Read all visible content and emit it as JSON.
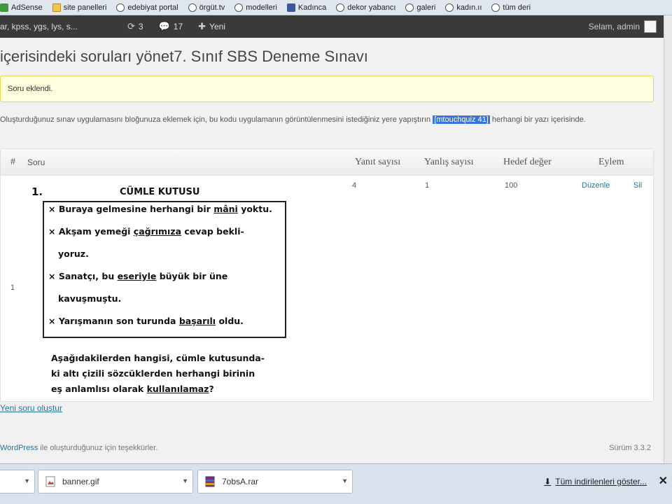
{
  "bookmarks": [
    {
      "label": "AdSense",
      "icon": "green-square-icon"
    },
    {
      "label": "site panelleri",
      "icon": "folder-icon"
    },
    {
      "label": "edebiyat portal",
      "icon": "globe-icon"
    },
    {
      "label": "örgüt.tv",
      "icon": "globe-icon"
    },
    {
      "label": "modelleri",
      "icon": "globe-icon"
    },
    {
      "label": "Kadınca",
      "icon": "facebook-icon"
    },
    {
      "label": "dekor yabancı",
      "icon": "globe-icon"
    },
    {
      "label": "galeri",
      "icon": "globe-icon"
    },
    {
      "label": "kadın.ıı",
      "icon": "globe-icon"
    },
    {
      "label": "tüm deri",
      "icon": "globe-icon"
    }
  ],
  "adminbar": {
    "site": "ar, kpss, ygs, lys, s...",
    "updates": "3",
    "comments": "17",
    "new_label": "Yeni",
    "greeting": "Selam, admin"
  },
  "page": {
    "title": "içerisindeki soruları yönet7. Sınıf SBS Deneme Sınavı",
    "notice": "Soru eklendi.",
    "info_before": "Oluşturduğunuz sınav uygulamasını bloğunuza eklemek için, bu kodu uygulamanın görüntülenmesini istediğiniz yere yapıştırın ",
    "shortcode": "[mtouchquiz 41]",
    "info_after": " herhangi bir yazı içerisinde."
  },
  "table": {
    "headers": {
      "num": "#",
      "question": "Soru",
      "answers": "Yanıt sayısı",
      "wrong": "Yanlış sayısı",
      "target": "Hedef değer",
      "actions": "Eylem"
    },
    "row": {
      "num": "1",
      "answers": "4",
      "wrong": "1",
      "target": "100",
      "edit": "Düzenle",
      "delete": "Sil"
    }
  },
  "question": {
    "number": "1.",
    "box_title": "CÜMLE KUTUSU",
    "lines": [
      {
        "pre": "× Buraya gelmesine herhangi bir ",
        "u": "mâni",
        "post": " yoktu."
      },
      {
        "pre": "× Akşam yemeği ",
        "u": "çağrımıza",
        "post": " cevap bekli-"
      },
      {
        "pre": "yoruz.",
        "u": "",
        "post": ""
      },
      {
        "pre": "× Sanatçı, bu ",
        "u": "eseriyle",
        "post": " büyük bir üne"
      },
      {
        "pre": "kavuşmuştu.",
        "u": "",
        "post": ""
      },
      {
        "pre": "× Yarışmanın son turunda ",
        "u": "başarılı",
        "post": " oldu."
      }
    ],
    "text_line1": "Aşağıdakilerden hangisi, cümle kutusunda-",
    "text_line2": "ki altı çizili sözcüklerden herhangi birinin",
    "text_line3_pre": "eş anlamlısı olarak ",
    "text_line3_u": "kullanılamaz",
    "text_line3_post": "?"
  },
  "new_question_link": "Yeni soru oluştur",
  "footer": {
    "wordpress": "WordPress",
    "thanks": " ile oluşturduğunuz için teşekkürler.",
    "version": "Sürüm 3.3.2"
  },
  "downloads": {
    "files": [
      "banner.gif",
      "7obsA.rar"
    ],
    "show_all": "Tüm indirilenleri göster..."
  }
}
